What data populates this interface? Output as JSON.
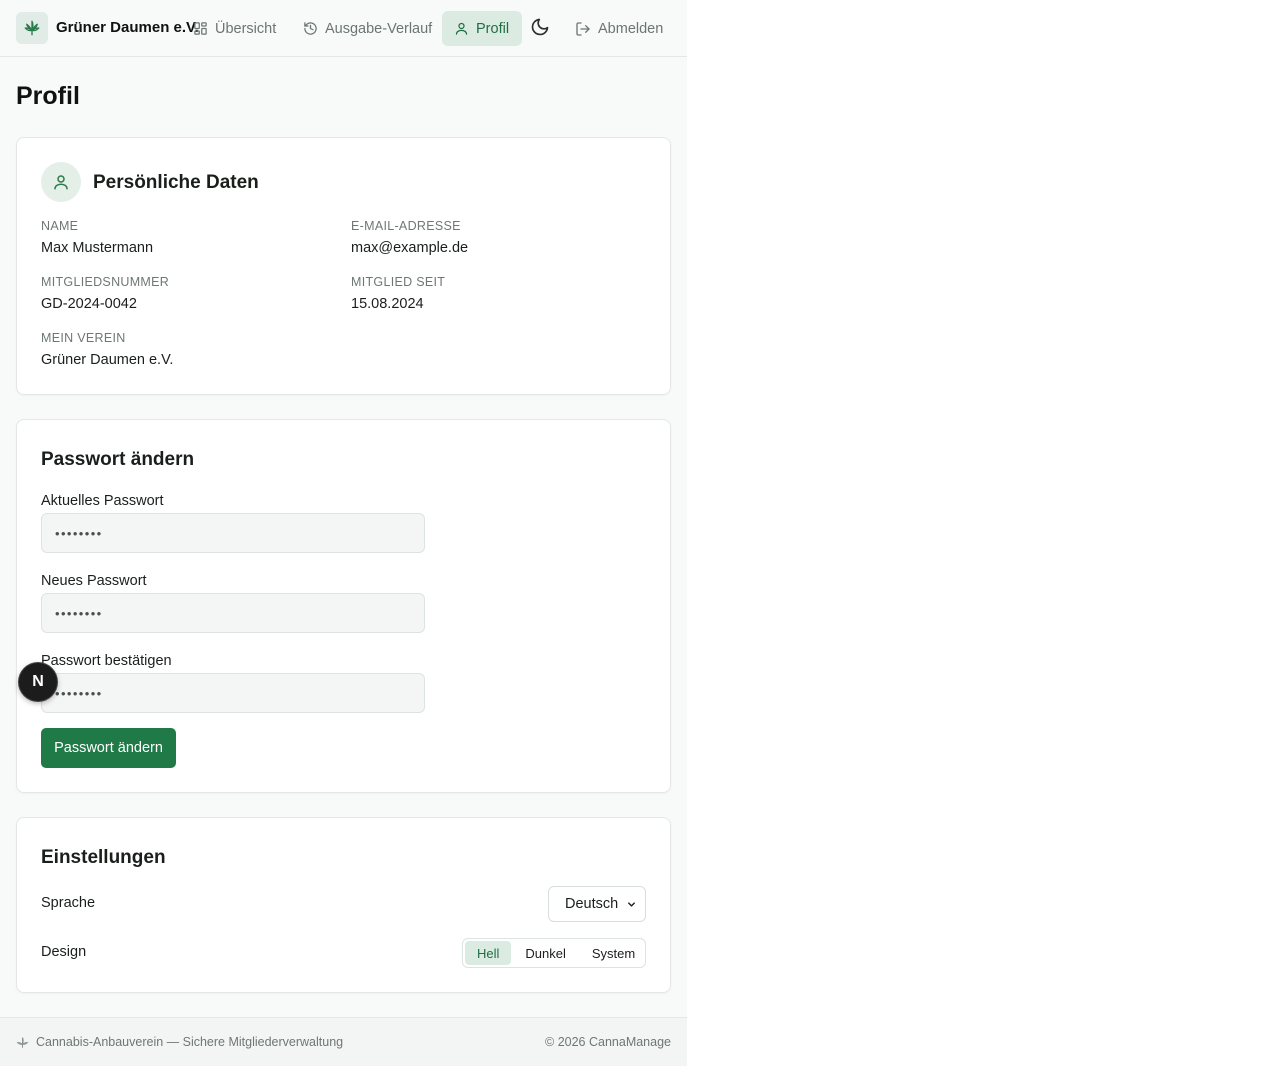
{
  "header": {
    "brand": "Grüner Daumen e.V.",
    "nav": [
      {
        "label": "Übersicht",
        "icon": "grid-icon"
      },
      {
        "label": "Ausgabe-Verlauf",
        "icon": "history-icon"
      },
      {
        "label": "Profil",
        "icon": "user-icon",
        "active": true
      }
    ],
    "theme_icon": "moon-icon",
    "logout_label": "Abmelden"
  },
  "page": {
    "title": "Profil"
  },
  "personal": {
    "title": "Persönliche Daten",
    "name_label": "Name",
    "name_value": "Max Mustermann",
    "email_label": "E-Mail-Adresse",
    "email_value": "max@example.de",
    "member_no_label": "Mitgliedsnummer",
    "member_no_value": "GD-2024-0042",
    "member_since_label": "Mitglied seit",
    "member_since_value": "15.08.2024",
    "club_label": "Mein Verein",
    "club_value": "Grüner Daumen e.V."
  },
  "password": {
    "title": "Passwort ändern",
    "current_label": "Aktuelles Passwort",
    "current_value": "••••••••",
    "new_label": "Neues Passwort",
    "new_value": "••••••••",
    "confirm_label": "Passwort bestätigen",
    "confirm_value": "••••••••",
    "submit_label": "Passwort ändern"
  },
  "settings": {
    "title": "Einstellungen",
    "language_label": "Sprache",
    "language_value": "Deutsch",
    "design_label": "Design",
    "design_options": [
      "Hell",
      "Dunkel",
      "System"
    ],
    "design_selected": "Hell"
  },
  "footer": {
    "left": "Cannabis-Anbauverein — Sichere Mitgliederverwaltung",
    "right": "© 2026 CannaManage"
  },
  "overlay": {
    "badge": "N"
  },
  "colors": {
    "accent": "#1f7a47",
    "accent_soft": "#dcebe2",
    "bg": "#f8fafa"
  }
}
